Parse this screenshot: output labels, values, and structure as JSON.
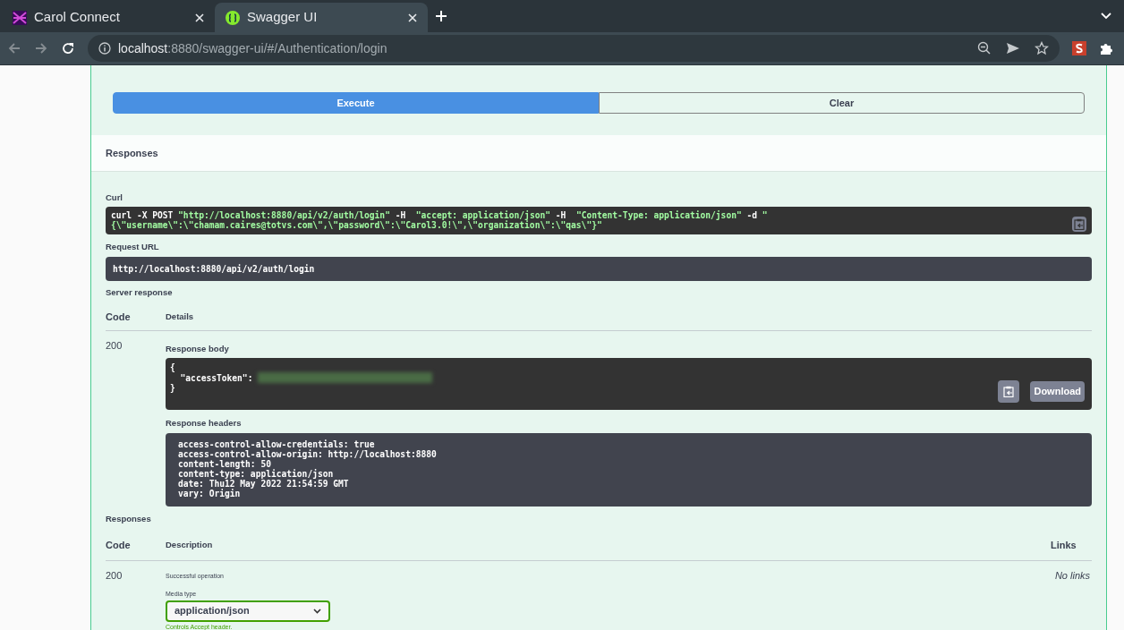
{
  "browser": {
    "tabs": [
      {
        "title": "Carol Connect",
        "selected": false
      },
      {
        "title": "Swagger UI",
        "selected": true
      }
    ],
    "url": {
      "host": "localhost",
      "path": ":8880/swagger-ui/#/Authentication/login"
    }
  },
  "actions": [
    {
      "label": "Execute",
      "kind": "primary"
    },
    {
      "label": "Clear",
      "kind": "secondary"
    }
  ],
  "responses_header": "Responses",
  "curl": {
    "label": "Curl",
    "lines": [
      [
        {
          "text": "curl -X POST ",
          "kind": "plain"
        },
        {
          "text": "\"http://localhost:8880/api/v2/auth/login\"",
          "kind": "string"
        },
        {
          "text": " -H  ",
          "kind": "plain"
        },
        {
          "text": "\"accept: application/json\"",
          "kind": "string"
        },
        {
          "text": " -H  ",
          "kind": "plain"
        },
        {
          "text": "\"Content-Type: application/json\"",
          "kind": "string"
        },
        {
          "text": " -d ",
          "kind": "plain"
        },
        {
          "text": "\"",
          "kind": "string"
        }
      ],
      [
        {
          "text": "{\\\"username\\\":\\\"chamam.caires@totvs.com\\\",\\\"password\\\":\\\"Carol3.0!\\\",\\\"organization\\\":\\\"qas\\\"}\"",
          "kind": "string"
        }
      ]
    ]
  },
  "request_url": {
    "label": "Request URL",
    "value": "http://localhost:8880/api/v2/auth/login"
  },
  "server_response": {
    "label": "Server response",
    "columns": [
      "Code",
      "Details"
    ],
    "code": "200",
    "body_label": "Response body",
    "body_lines": [
      {
        "text": "{",
        "redacted": false
      },
      {
        "text": "  \"accessToken\": ",
        "redacted": true
      },
      {
        "text": "}",
        "redacted": false
      }
    ],
    "download": "Download",
    "headers_label": "Response headers",
    "headers": [
      "access-control-allow-credentials: true",
      "access-control-allow-origin: http://localhost:8880",
      "content-length: 50",
      "content-type: application/json",
      "date: Thu12 May 2022 21:54:59 GMT",
      "vary: Origin"
    ]
  },
  "responses": {
    "label": "Responses",
    "columns": [
      "Code",
      "Description",
      "Links"
    ],
    "rows": [
      {
        "code": "200",
        "description": "Successful operation",
        "links": "No links",
        "media_type_label": "Media type",
        "media_type": "application/json",
        "media_hint": "Controls Accept header."
      }
    ]
  }
}
